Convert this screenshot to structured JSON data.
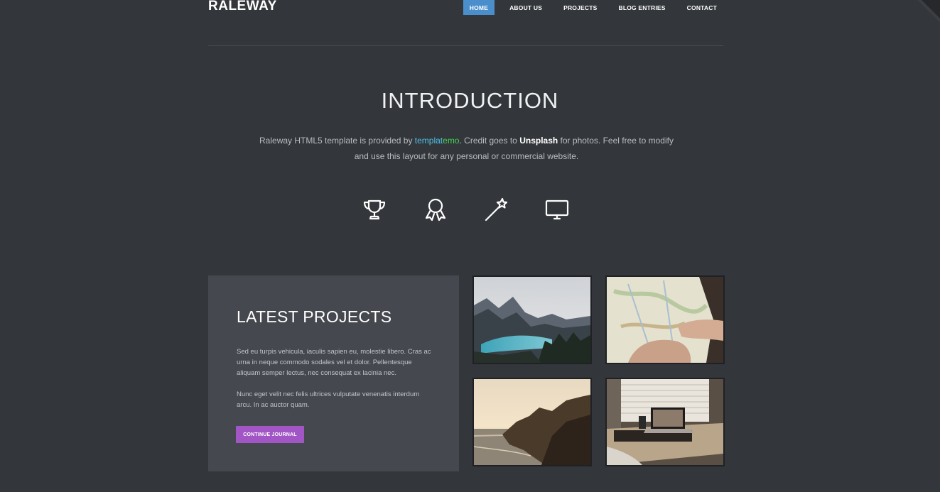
{
  "header": {
    "logo": "RALEWAY",
    "nav": [
      {
        "label": "HOME",
        "active": true
      },
      {
        "label": "ABOUT US",
        "active": false
      },
      {
        "label": "PROJECTS",
        "active": false
      },
      {
        "label": "BLOG ENTRIES",
        "active": false
      },
      {
        "label": "CONTACT",
        "active": false
      }
    ]
  },
  "intro": {
    "title": "INTRODUCTION",
    "text_1": "Raleway HTML5 template is provided by ",
    "link_a": "templat",
    "link_b": "emo",
    "text_2": ". Credit goes to ",
    "strong": "Unsplash",
    "text_3": " for photos. Feel free to modify and use this layout for any personal or commercial website."
  },
  "icons": [
    "trophy-icon",
    "award-ribbon-icon",
    "magic-wand-icon",
    "monitor-icon"
  ],
  "projects": {
    "title": "LATEST PROJECTS",
    "paragraph_1": "Sed eu turpis vehicula, iaculis sapien eu, molestie libero. Cras ac urna in neque commodo sodales vel et dolor. Pellentesque aliquam semper lectus, nec consequat ex lacinia nec.",
    "paragraph_2": "Nunc eget velit nec felis ultrices vulputate venenatis interdum arcu. In ac auctor quam.",
    "button": "CONTINUE JOURNAL"
  },
  "thumbnails": [
    "mountain-lake-photo",
    "map-in-hands-photo",
    "coastal-cliff-photo",
    "laptop-desk-photo"
  ],
  "colors": {
    "background": "#33363a",
    "panel": "#45484e",
    "nav_active": "#4a8fcb",
    "button": "#a255c4",
    "link_blue": "#4fc1e9",
    "link_green": "#46d35a"
  }
}
